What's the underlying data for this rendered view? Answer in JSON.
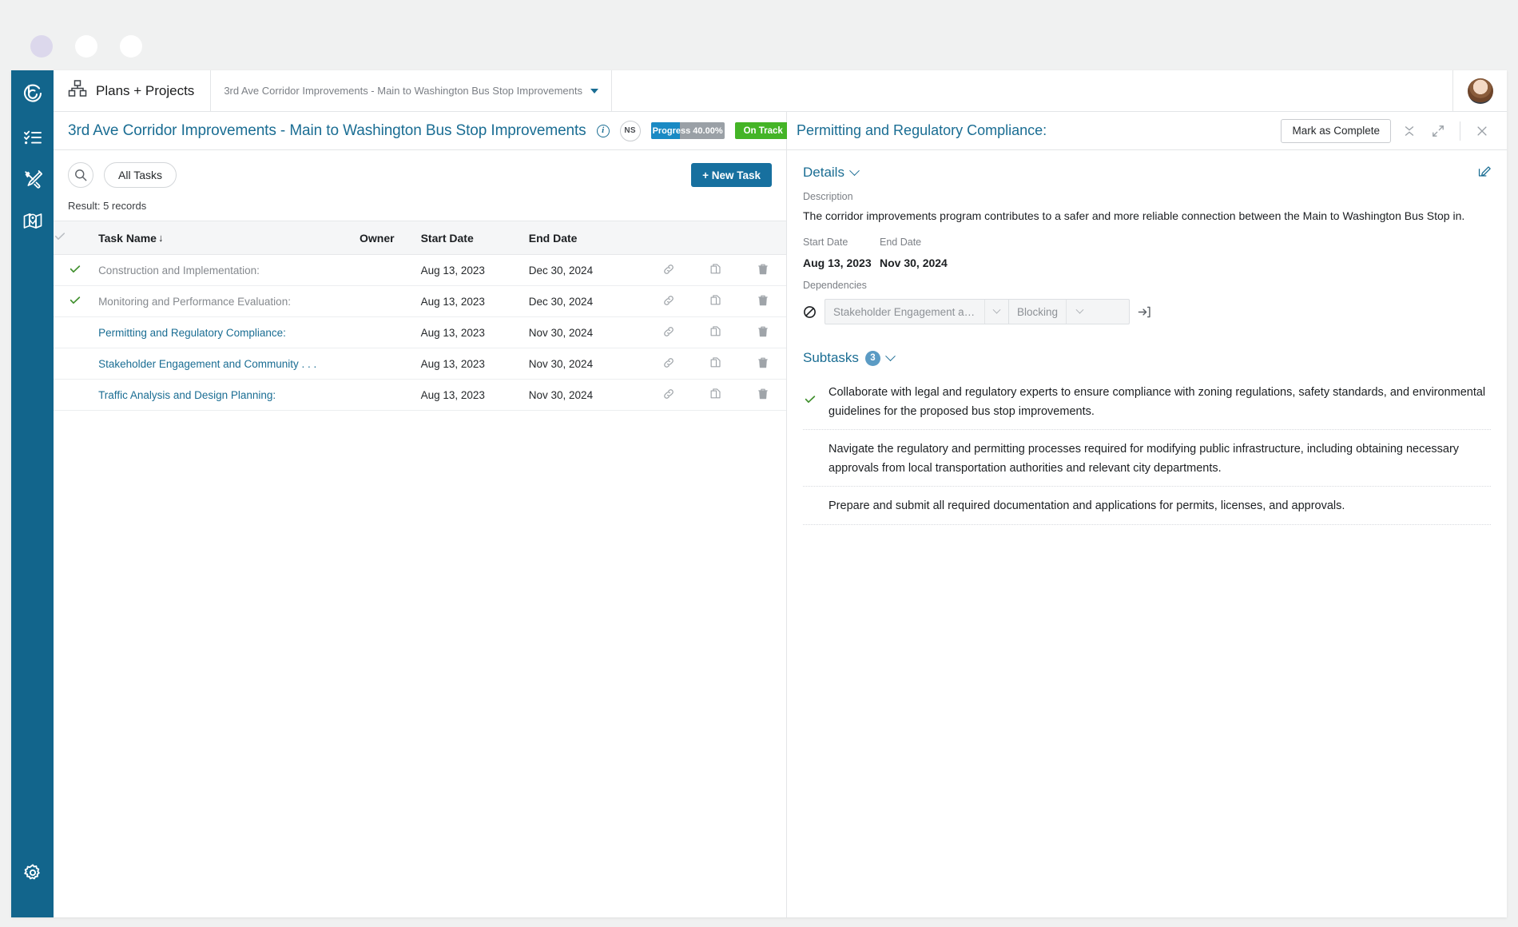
{
  "window": {
    "dots": [
      "dot-purple",
      "dot-white",
      "dot-white"
    ]
  },
  "topbar": {
    "app_label": "Plans + Projects",
    "breadcrumb_project": "3rd Ave Corridor Improvements - Main to Washington Bus Stop Improvements",
    "app_icon": "org-chart-icon",
    "caret_icon": "caret-down-icon",
    "avatar_icon": "user-avatar"
  },
  "rail": {
    "items": [
      {
        "icon": "company-logo-icon",
        "name": "logo"
      },
      {
        "icon": "checklist-icon",
        "name": "tasks"
      },
      {
        "icon": "tools-icon",
        "name": "tools"
      },
      {
        "icon": "map-icon",
        "name": "map"
      }
    ],
    "bottom": {
      "icon": "gear-icon",
      "name": "settings"
    }
  },
  "project": {
    "title": "3rd Ave Corridor Improvements - Main to Washington Bus Stop Improvements",
    "info_icon": "info-icon",
    "initials": "NS",
    "progress_label": "Progress 40.00%",
    "progress_percent": 40,
    "progress_fill_color": "#1a8ac4",
    "progress_track_color": "#9aa0a6",
    "status_label": "On Track",
    "status_color": "#44b426",
    "edit_icon": "edit-pencil-icon"
  },
  "toolbar": {
    "search_icon": "search-icon",
    "filter_label": "All Tasks",
    "new_task_label": "+ New Task",
    "result_text": "Result: 5 records"
  },
  "table": {
    "columns": [
      "",
      "Task Name",
      "Owner",
      "Start Date",
      "End Date"
    ],
    "sort_column": "Task Name",
    "sort_arrow": "↓",
    "rows": [
      {
        "done": true,
        "name": "Construction and Implementation:",
        "owner": "",
        "start": "Aug 13, 2023",
        "end": "Dec 30, 2024"
      },
      {
        "done": true,
        "name": "Monitoring and Performance Evaluation:",
        "owner": "",
        "start": "Aug 13, 2023",
        "end": "Dec 30, 2024"
      },
      {
        "done": false,
        "name": "Permitting and Regulatory Compliance:",
        "owner": "",
        "start": "Aug 13, 2023",
        "end": "Nov 30, 2024"
      },
      {
        "done": false,
        "name": "Stakeholder Engagement and Community . . .",
        "owner": "",
        "start": "Aug 13, 2023",
        "end": "Nov 30, 2024"
      },
      {
        "done": false,
        "name": "Traffic Analysis and Design Planning:",
        "owner": "",
        "start": "Aug 13, 2023",
        "end": "Nov 30, 2024"
      }
    ],
    "row_actions": [
      "link-icon",
      "copy-icon",
      "trash-icon"
    ]
  },
  "detail": {
    "title": "Permitting and Regulatory Compliance:",
    "mark_complete_label": "Mark as Complete",
    "collapse_icon": "collapse-icon",
    "expand_icon": "expand-icon",
    "close_icon": "close-icon",
    "edit_icon": "edit-pencil-icon",
    "details_label": "Details",
    "description_label": "Description",
    "description": "The corridor improvements program contributes to a safer and more reliable connection between the Main to Washington Bus Stop in.",
    "start_date_label": "Start Date",
    "start_date": "Aug 13, 2023",
    "end_date_label": "End Date",
    "end_date": "Nov 30, 2024",
    "dependencies_label": "Dependencies",
    "dependency_block_icon": "no-entry-icon",
    "dependency_task": "Stakeholder Engagement and Co..",
    "dependency_type": "Blocking",
    "dependency_goto_icon": "go-to-icon",
    "subtasks_label": "Subtasks",
    "subtasks_count": "3",
    "subtasks": [
      {
        "done": true,
        "text": "Collaborate with legal and regulatory experts to ensure compliance with zoning regulations, safety standards, and environmental guidelines for the proposed bus stop improvements."
      },
      {
        "done": false,
        "text": "Navigate the regulatory and permitting processes required for modifying public infrastructure, including obtaining necessary approvals from local transportation authorities and relevant city departments."
      },
      {
        "done": false,
        "text": "Prepare and submit all required documentation and applications for permits, licenses, and approvals."
      }
    ]
  }
}
